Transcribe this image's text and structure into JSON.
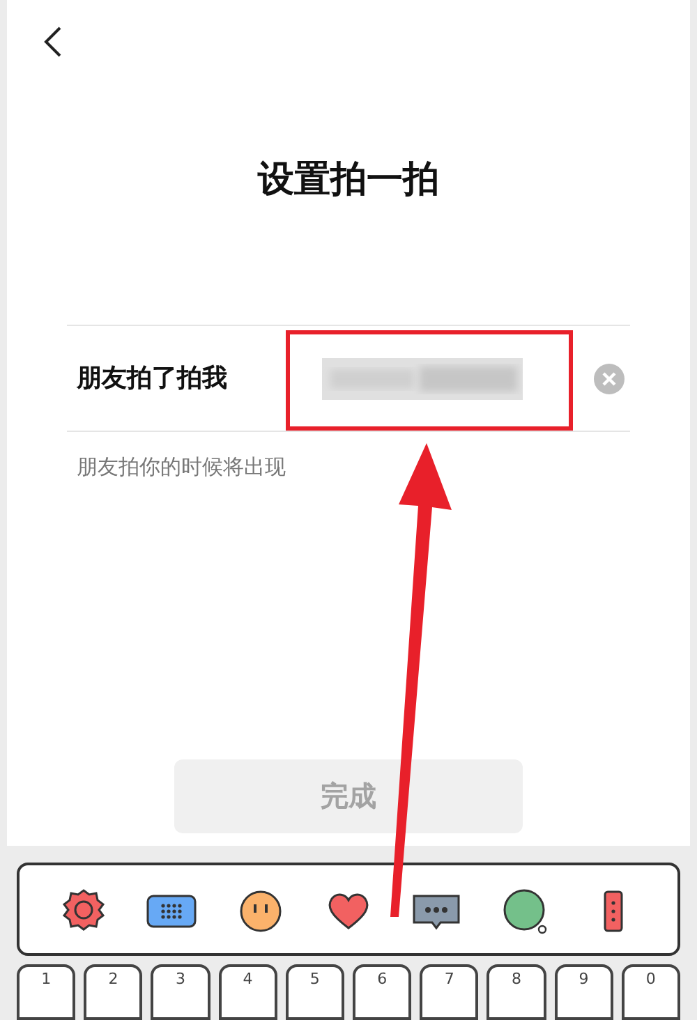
{
  "header": {
    "title": "设置拍一拍"
  },
  "field": {
    "label": "朋友拍了拍我",
    "hint": "朋友拍你的时候将出现"
  },
  "done_button": {
    "label": "完成",
    "disabled": true
  },
  "keyboard": {
    "keys": [
      "1",
      "2",
      "3",
      "4",
      "5",
      "6",
      "7",
      "8",
      "9",
      "0"
    ]
  }
}
